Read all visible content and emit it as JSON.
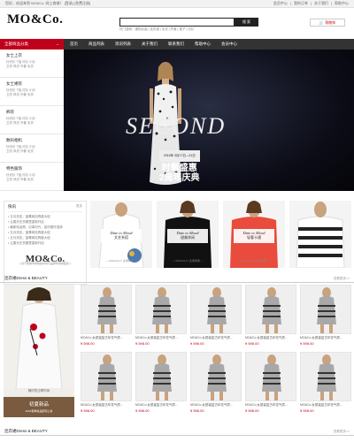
{
  "topbar": {
    "left": "您好，欢迎来到 MO&Co. 网上商城！",
    "login": "[登录]",
    "register": "[免费注册]",
    "links": [
      "会员中心",
      "我的订单",
      "关于我们",
      "帮助中心"
    ]
  },
  "header": {
    "logo": "MO&Co.",
    "search_placeholder": "",
    "search_button": "搜 索",
    "hot_words": "热门搜索：通勤女装 | 连衣裙 | 毛衣 | 外套 | 裙子 | 衬衫",
    "cart": "购物车"
  },
  "nav": {
    "all": "全部商品分类",
    "items": [
      "首页",
      "商品列表",
      "资讯列表",
      "关于我们",
      "联系我们",
      "帮助中心",
      "会员中心"
    ]
  },
  "categories": [
    {
      "title": "女士上衣",
      "sub": "针织衫 T恤 衬衫 小衫\n卫衣 风衣 外套 毛衣"
    },
    {
      "title": "女士裙装",
      "sub": "针织衫 T恤 衬衫 小衫\n卫衣 风衣 外套 毛衣"
    },
    {
      "title": "裤装",
      "sub": "针织衫 T恤 衬衫 小衫\n卫衣 风衣 外套 毛衣"
    },
    {
      "title": "数码相机",
      "sub": "针织衫 T恤 衬衫 小衫\n卫衣 风衣 外套 毛衣"
    },
    {
      "title": "特色服饰",
      "sub": "针织衫 T恤 衬衫 小衫\n卫衣 风衣 外套 毛衣"
    }
  ],
  "banner": {
    "season": "SECOND",
    "pill": "2016年 3月17日—31日",
    "main": "时髦盛惠\n2周年庆典"
  },
  "news": {
    "title": "快讯",
    "more": "更多",
    "items": [
      "• 五月流言，蓝莓网站再度大促",
      "• 让春天在衣橱里重新开启",
      "• 最新电话物，纪事时代，如何更好选择",
      "• 五月流言，蓝莓网站再度大促",
      "• 五月流言，蓝莓网站再度大促",
      "• 让春天在衣橱里重新开启"
    ],
    "brand": "MO&Co.",
    "brand_sub": "[ 基于各城市的快捷时尚与品牌时尚的结合 ]"
  },
  "promos": [
    {
      "a": "Date to Mood",
      "b": "文艺系搭",
      "d": "— 2016.04.17 全场特惠 —"
    },
    {
      "a": "Date to Mood",
      "b": "甜美休闲",
      "d": "— 2016.04.17 全场特惠 —"
    },
    {
      "a": "Date to Mood",
      "b": "轻奢卡通",
      "d": "— 2016.04.17 全场特惠 —"
    },
    {
      "a": "",
      "b": "",
      "d": ""
    }
  ],
  "section1": {
    "title": "连衣裙Dress & BEAUTY",
    "more": "查看更多>>"
  },
  "section2": {
    "title": "连衣裙Dress & BEAUTY",
    "more": "查看更多>>"
  },
  "feature": {
    "caption": "随时的当季时尚",
    "btn": "初夏新品",
    "btn_sub": "2016夏季新品即刻上新"
  },
  "product": {
    "name": "MO&Co.女夏装复古印花气质...",
    "price": "¥ 598.00"
  },
  "colors": {
    "accent": "#c0001b",
    "nav": "#333333",
    "dark": "#222222",
    "brown": "#7a5b3f"
  }
}
